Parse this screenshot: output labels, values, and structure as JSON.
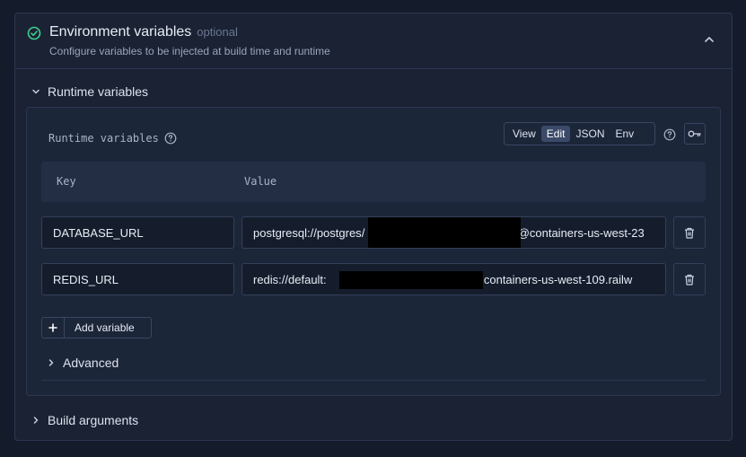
{
  "header": {
    "title": "Environment variables",
    "optional": "optional",
    "subtitle": "Configure variables to be injected at build time and runtime"
  },
  "runtime_section": {
    "label": "Runtime variables"
  },
  "editor": {
    "title": "Runtime variables",
    "modes": [
      "View",
      "Edit",
      "JSON",
      "Env"
    ],
    "active_mode": "Edit",
    "columns": {
      "key": "Key",
      "value": "Value"
    },
    "rows": [
      {
        "key": "DATABASE_URL",
        "value_prefix": "postgresql://postgres",
        "value_suffix": "@containers-us-west-23"
      },
      {
        "key": "REDIS_URL",
        "value_prefix": "redis://default:",
        "value_suffix": "@containers-us-west-109.railw"
      }
    ],
    "add_label": "Add variable",
    "advanced_label": "Advanced"
  },
  "build_section": {
    "label": "Build arguments"
  },
  "colors": {
    "accent": "#3fcf8e",
    "background": "#141b2a",
    "panel": "#1a2234"
  }
}
